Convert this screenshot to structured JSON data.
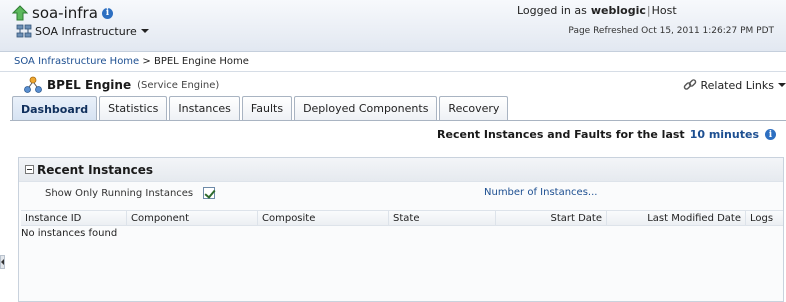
{
  "header": {
    "app_title": "soa-infra",
    "target_menu": "SOA Infrastructure",
    "logged_in_as_label": "Logged in as",
    "user": "weblogic",
    "separator": "|",
    "host_label": "Host",
    "page_refreshed": "Page Refreshed Oct 15, 2011 1:26:27 PM PDT"
  },
  "breadcrumb": {
    "link": "SOA Infrastructure Home",
    "separator": " > ",
    "current": "BPEL Engine Home"
  },
  "page": {
    "title": "BPEL Engine",
    "subtitle": "(Service Engine)",
    "related_links": "Related Links"
  },
  "tabs": [
    {
      "label": "Dashboard",
      "active": true
    },
    {
      "label": "Statistics"
    },
    {
      "label": "Instances"
    },
    {
      "label": "Faults"
    },
    {
      "label": "Deployed Components"
    },
    {
      "label": "Recovery"
    }
  ],
  "recent_filter": {
    "label": "Recent Instances and Faults for the last",
    "period": "10 minutes"
  },
  "recent_instances": {
    "title": "Recent Instances",
    "show_running_label": "Show Only Running Instances",
    "show_running_checked": true,
    "number_link": "Number of Instances...",
    "columns": [
      "Instance ID",
      "Component",
      "Composite",
      "State",
      "Start Date",
      "Last Modified Date",
      "Logs"
    ],
    "empty_message": "No instances found"
  },
  "colors": {
    "link": "#1d4f91",
    "header_bg": "#e2e8f1",
    "info_icon": "#2d6fc1",
    "active_tab_text": "#0f2f5c"
  },
  "icons": {
    "app": "green-up-arrow-icon",
    "info": "info-icon",
    "target": "server-tree-icon",
    "engine": "bpel-engine-icon",
    "related": "link-chain-icon"
  }
}
